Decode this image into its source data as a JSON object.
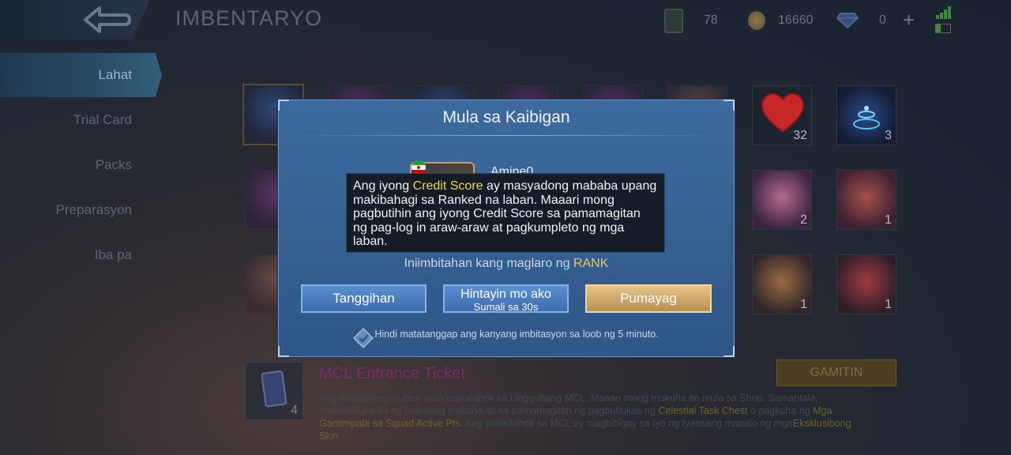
{
  "header": {
    "title": "IMBENTARYO",
    "tickets": "78",
    "coins": "16660",
    "diamonds": "0",
    "plus": "+"
  },
  "sidebar": {
    "items": [
      {
        "label": "Lahat",
        "active": true
      },
      {
        "label": "Trial Card"
      },
      {
        "label": "Packs"
      },
      {
        "label": "Preparasyon"
      },
      {
        "label": "Iba pa"
      }
    ]
  },
  "grid": {
    "counts": {
      "heart": "32",
      "aura": "3",
      "hero_a": "2",
      "hero_b": "1",
      "hero_c": "1",
      "hero_d": "1"
    }
  },
  "detail": {
    "count": "4",
    "name": "MCL Entrance Ticket",
    "desc_1": "Ang kinakailangan item para makalahok sa Lingguhang MCL. Maaari mong makuha ito mula sa Shop. Samantala, makakakuha ka ng tyansang makuha ito sa pamamagitan ng pagbubukas ng ",
    "desc_hl_1": "Celestial Task Chest",
    "desc_2": " o pagkuha ng ",
    "desc_hl_2": "Mga Gantimpala sa Squad Active Pts",
    "desc_3": ". Ang pakikilahok sa MCL ay magbibigay sa iyo ng tyansang manalo ng mga",
    "desc_hl_3": "Eksklusibong Skin",
    "desc_4": ".",
    "use_button": "GAMITIN"
  },
  "modal": {
    "title": "Mula sa Kaibigan",
    "friend_name": "Amine0",
    "invite_prefix": "Iniimbitahan kang maglaro ng ",
    "invite_mode": "RANK",
    "decline_button": "Tanggihan",
    "wait_button": "Hintayin mo ako",
    "wait_sub": "Sumali sa 30s",
    "accept_button": "Pumayag",
    "notice": "Hindi matatanggap ang kanyang imbitasyon sa loob ng 5 minuto."
  },
  "tooltip": {
    "pre": "Ang iyong ",
    "highlight": "Credit Score",
    "post": " ay masyadong mababa upang makibahagi sa Ranked na laban. Maaari mong pagbutihin ang iyong Credit Score sa pamamagitan ng pag-log in araw-araw at pagkumpleto ng mga laban."
  },
  "colors": {
    "modal_bg": "#3d6a9e",
    "accept_gold": "#e6c488",
    "rank_highlight": "#f1c45a",
    "credit_highlight": "#f2d74a"
  }
}
